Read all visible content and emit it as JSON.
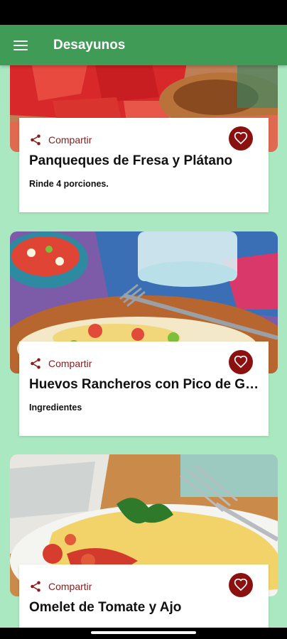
{
  "app_bar": {
    "title": "Desayunos",
    "menu_icon": "hamburger-menu-icon"
  },
  "recipes": [
    {
      "title": "Panqueques de Fresa y Plátano",
      "subtitle": "Rinde 4 porciones.",
      "share_label": "Compartir"
    },
    {
      "title": "Huevos Rancheros con Pico de Gallo",
      "subtitle": "Ingredientes",
      "share_label": "Compartir"
    },
    {
      "title": "Omelet de Tomate y Ajo",
      "subtitle": "",
      "share_label": "Compartir"
    }
  ],
  "colors": {
    "app_bar": "#3f9b55",
    "background": "#a9e8c0",
    "accent": "#8b1010"
  }
}
